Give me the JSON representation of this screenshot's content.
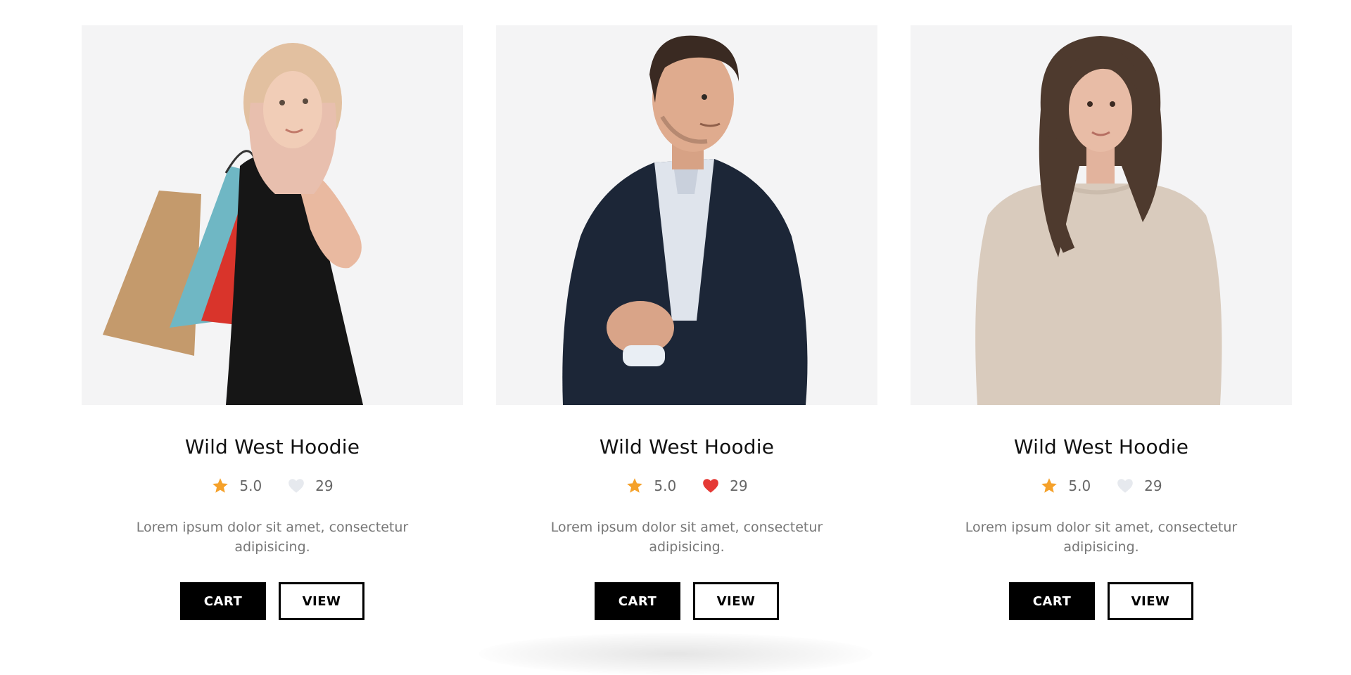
{
  "products": [
    {
      "image": "woman-with-shopping-bags-photo",
      "title": "Wild West Hoodie",
      "rating": "5.0",
      "likes": "29",
      "liked": false,
      "description": "Lorem ipsum dolor sit amet, consectetur adipisicing.",
      "cart_label": "CART",
      "view_label": "VIEW"
    },
    {
      "image": "man-in-navy-blazer-photo",
      "title": "Wild West Hoodie",
      "rating": "5.0",
      "likes": "29",
      "liked": true,
      "description": "Lorem ipsum dolor sit amet, consectetur adipisicing.",
      "cart_label": "CART",
      "view_label": "VIEW"
    },
    {
      "image": "woman-in-beige-sweater-photo",
      "title": "Wild West Hoodie",
      "rating": "5.0",
      "likes": "29",
      "liked": false,
      "description": "Lorem ipsum dolor sit amet, consectetur adipisicing.",
      "cart_label": "CART",
      "view_label": "VIEW"
    }
  ],
  "colors": {
    "star": "#f5a12a",
    "heart_liked": "#e53935",
    "heart_unliked": "#e6e9ee",
    "button_dark": "#000000",
    "photo_bg": "#f4f4f5"
  },
  "icons": {
    "rating": "star-icon",
    "likes": "heart-icon"
  }
}
